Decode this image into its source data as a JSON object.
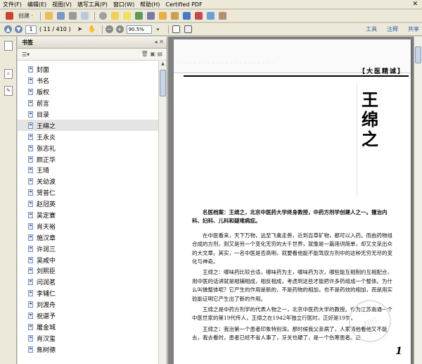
{
  "menu": {
    "items": [
      "文件(F)",
      "编辑(E)",
      "视图(V)",
      "填写工具(P)",
      "窗口(W)",
      "帮助(H)",
      "Certified PDF"
    ],
    "close": "✕"
  },
  "toolbar": {
    "create_label": "创建 ·",
    "zoom_value": "90.5%",
    "page_value": "1",
    "page_count": "( 11 / 410 )",
    "links": [
      "工具",
      "注释",
      "共享"
    ]
  },
  "bookmarks": {
    "title": "书签",
    "items": [
      "封面",
      "书名",
      "版权",
      "前言",
      "目录",
      "王绵之",
      "王永炎",
      "张志礼",
      "颜正华",
      "王琦",
      "关幼波",
      "贺普仁",
      "赵冠英",
      "吴定寰",
      "肖天裕",
      "施汉章",
      "许润三",
      "吴咸中",
      "刘熙臣",
      "闫润茗",
      "李辅仁",
      "刘渡舟",
      "祝谌予",
      "屠金城",
      "肖汉玺",
      "焦树德"
    ],
    "selected_index": 5
  },
  "document": {
    "section_tag": "【大医精诚】",
    "name_title": "王绵之",
    "intro": "名医档案：王绵之，北京中医药大学终身教授，中药方剂学创建人之一。擅治内科、妇科、儿科和疑难病症。",
    "paragraphs": [
      "在中医看来，天下万物，远至飞禽走兽，近到百草矿物，都可以入药。而由药物组合成的方剂，则又是另一个变化无穷的大千世界，就像是一篇用词简单，却又文采出众的大文章。其实，一名中医是否高明，就要看他能不能驾驭方剂中的这种无穷无尽的变化与神奇。",
      "王绵之：哪味药比较合适，哪味药为主，哪味药为次，哪些能互相制约互相配合，用中医的话讲就是相辅相成，相反相成，考虑到这些才能把许多药组成一个整体。为什么叫做整体呢？它产生的作用是新的，不是药物的相加，也不是药效的相加，而是用实验能证明它产生出了新的作用。",
      "王绵之是中药方剂学的代表人物之一，北京中医药大学的教授。作为江苏南通一个中医世家的第19代传人，王绵之在1942年独立行医时，正好是19岁。",
      "王绵之：我治第一个患者印象特别深。那时候我父亲病了，人家请他看他又不能去，我去看时，患者已经不省人事了，牙关也硬了，是一个伤寒患者。后"
    ],
    "page_number": "1",
    "watermark_text": "PDG"
  }
}
